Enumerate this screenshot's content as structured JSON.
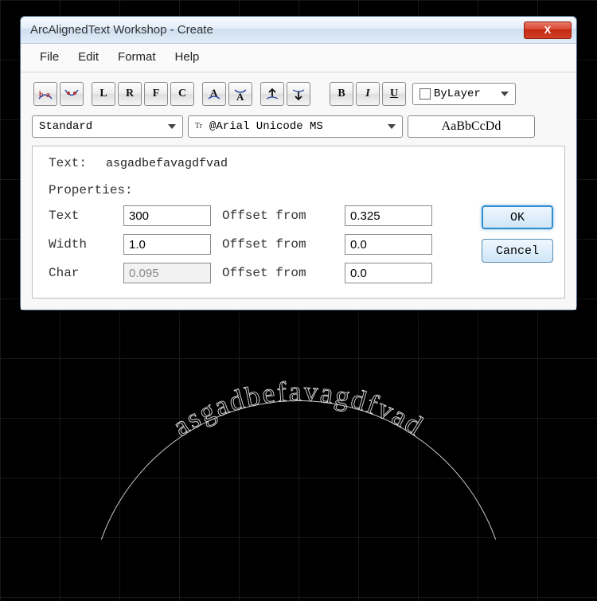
{
  "window": {
    "title": "ArcAlignedText Workshop - Create",
    "close_glyph": "X"
  },
  "menu": {
    "file": "File",
    "edit": "Edit",
    "format": "Format",
    "help": "Help"
  },
  "toolbar": {
    "bylayer_label": "ByLayer",
    "bold": "B",
    "italic": "I",
    "underline": "U",
    "btn_L": "L",
    "btn_R": "R",
    "btn_F": "F",
    "btn_C": "C"
  },
  "second_row": {
    "style": "Standard",
    "font": "@Arial Unicode MS",
    "sample": "AaBbCcDd"
  },
  "main": {
    "text_label": "Text:",
    "text_value": "asgadbefavagdfvad",
    "props_label": "Properties:",
    "rows": {
      "text": {
        "label": "Text",
        "v1": "300",
        "mid": "Offset from",
        "v2": "0.325"
      },
      "width": {
        "label": "Width",
        "v1": "1.0",
        "mid": "Offset from",
        "v2": "0.0"
      },
      "char": {
        "label": "Char",
        "v1": "0.095",
        "mid": "Offset from",
        "v2": "0.0"
      }
    },
    "buttons": {
      "ok": "OK",
      "cancel": "Cancel"
    }
  },
  "arc_text": "asgadbefavagdfvad"
}
